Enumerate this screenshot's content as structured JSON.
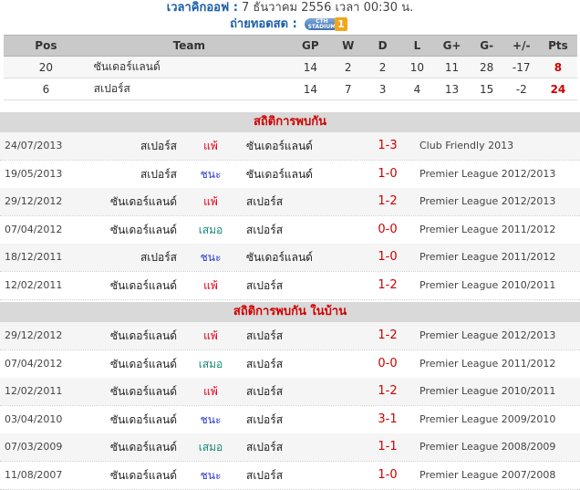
{
  "kickoff": {
    "label": "เวลาคิกออฟ :",
    "value": "7 ธันวาคม 2556 เวลา 00:30 น."
  },
  "tv": {
    "label": "ถ่ายทอดสด :",
    "logo_text": "CTH STADIUM",
    "logo_num": "1"
  },
  "standings": {
    "headers": [
      "Pos",
      "Team",
      "GP",
      "W",
      "D",
      "L",
      "G+",
      "G-",
      "+/-",
      "Pts"
    ],
    "rows": [
      {
        "pos": "20",
        "team": "ซันเดอร์แลนด์",
        "gp": "14",
        "w": "2",
        "d": "2",
        "l": "10",
        "gf": "11",
        "ga": "28",
        "gd": "-17",
        "pts": "8"
      },
      {
        "pos": "6",
        "team": "สเปอร์ส",
        "gp": "14",
        "w": "7",
        "d": "3",
        "l": "4",
        "gf": "13",
        "ga": "15",
        "gd": "-2",
        "pts": "24"
      }
    ]
  },
  "h2h": {
    "title": "สถิติการพบกัน",
    "matches": [
      {
        "date": "24/07/2013",
        "home": "สเปอร์ส",
        "result": "แพ้",
        "away": "ซันเดอร์แลนด์",
        "score": "1-3",
        "comp": "Club Friendly 2013"
      },
      {
        "date": "19/05/2013",
        "home": "สเปอร์ส",
        "result": "ชนะ",
        "away": "ซันเดอร์แลนด์",
        "score": "1-0",
        "comp": "Premier League 2012/2013"
      },
      {
        "date": "29/12/2012",
        "home": "ซันเดอร์แลนด์",
        "result": "แพ้",
        "away": "สเปอร์ส",
        "score": "1-2",
        "comp": "Premier League 2012/2013"
      },
      {
        "date": "07/04/2012",
        "home": "ซันเดอร์แลนด์",
        "result": "เสมอ",
        "away": "สเปอร์ส",
        "score": "0-0",
        "comp": "Premier League 2011/2012"
      },
      {
        "date": "18/12/2011",
        "home": "สเปอร์ส",
        "result": "ชนะ",
        "away": "ซันเดอร์แลนด์",
        "score": "1-0",
        "comp": "Premier League 2011/2012"
      },
      {
        "date": "12/02/2011",
        "home": "ซันเดอร์แลนด์",
        "result": "แพ้",
        "away": "สเปอร์ส",
        "score": "1-2",
        "comp": "Premier League 2010/2011"
      }
    ]
  },
  "h2h_home": {
    "title": "สถิติการพบกัน ในบ้าน",
    "matches": [
      {
        "date": "29/12/2012",
        "home": "ซันเดอร์แลนด์",
        "result": "แพ้",
        "away": "สเปอร์ส",
        "score": "1-2",
        "comp": "Premier League 2012/2013"
      },
      {
        "date": "07/04/2012",
        "home": "ซันเดอร์แลนด์",
        "result": "เสมอ",
        "away": "สเปอร์ส",
        "score": "0-0",
        "comp": "Premier League 2011/2012"
      },
      {
        "date": "12/02/2011",
        "home": "ซันเดอร์แลนด์",
        "result": "แพ้",
        "away": "สเปอร์ส",
        "score": "1-2",
        "comp": "Premier League 2010/2011"
      },
      {
        "date": "03/04/2010",
        "home": "ซันเดอร์แลนด์",
        "result": "ชนะ",
        "away": "สเปอร์ส",
        "score": "3-1",
        "comp": "Premier League 2009/2010"
      },
      {
        "date": "07/03/2009",
        "home": "ซันเดอร์แลนด์",
        "result": "เสมอ",
        "away": "สเปอร์ส",
        "score": "1-1",
        "comp": "Premier League 2008/2009"
      },
      {
        "date": "11/08/2007",
        "home": "ซันเดอร์แลนด์",
        "result": "ชนะ",
        "away": "สเปอร์ส",
        "score": "1-0",
        "comp": "Premier League 2007/2008"
      }
    ]
  }
}
